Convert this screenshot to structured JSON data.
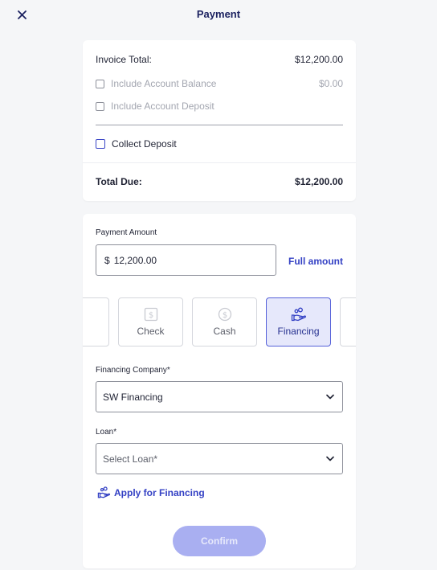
{
  "header": {
    "title": "Payment"
  },
  "summary": {
    "invoice_total_label": "Invoice Total:",
    "invoice_total_value": "$12,200.00",
    "include_balance_label": "Include Account Balance",
    "include_balance_value": "$0.00",
    "include_deposit_label": "Include Account Deposit",
    "collect_deposit_label": "Collect Deposit",
    "total_due_label": "Total Due:",
    "total_due_value": "$12,200.00"
  },
  "payment": {
    "amount_label": "Payment Amount",
    "currency_symbol": "$",
    "amount_value": "12,200.00",
    "full_amount_label": "Full amount",
    "methods": [
      {
        "label": "Check",
        "icon": "check-icon",
        "selected": false
      },
      {
        "label": "Cash",
        "icon": "cash-icon",
        "selected": false
      },
      {
        "label": "Financing",
        "icon": "financing-icon",
        "selected": true
      }
    ],
    "financing_company_label": "Financing Company*",
    "financing_company_value": "SW Financing",
    "loan_label": "Loan*",
    "loan_placeholder": "Select Loan*",
    "apply_label": "Apply for Financing",
    "confirm_label": "Confirm"
  },
  "colors": {
    "accent": "#3340c4",
    "selected_bg": "#e6e8fb",
    "confirm_bg": "#a9aff1"
  }
}
